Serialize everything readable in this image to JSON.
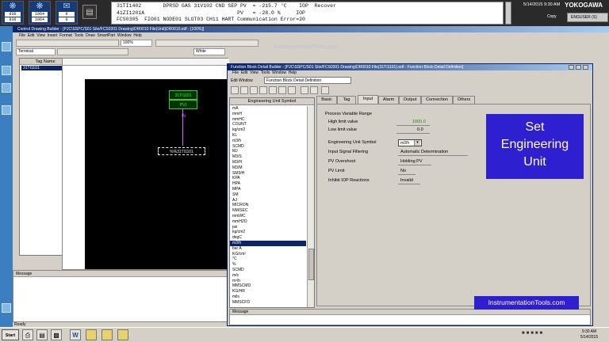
{
  "system_bar": {
    "icons": [
      {
        "count_top": "936",
        "count_bottom": "936"
      },
      {
        "count_top": "1064",
        "count_bottom": "1064"
      },
      {
        "count_top": "0",
        "count_bottom": "0"
      }
    ],
    "alarm_lines": [
      "31TI1402       DPRSD GAS 31V102 CND SEP PV  = -215.7 °C    IOP  Recover",
      "41ZI1201A                              PV   = -28.0 %     IOP",
      "FCS0305  FIO01 NODE01 SLOT03 CH11 HART Communication Error=20"
    ],
    "date": "5/14/2015",
    "time": "9:30 AM",
    "logo": "YOKOGAWA",
    "copy_label": "Copy",
    "user": "ENGUSER (S)"
  },
  "cdb": {
    "title": "Control Drawing Builder - [PJC\\SSPC/S01 Site/FCS0301 Drawing\\DR0010 File(Unit)DR0010.edf - [100%]]",
    "menu": [
      "File",
      "Edit",
      "View",
      "Insert",
      "Format",
      "Tools",
      "Draw",
      "SmartPart",
      "Window",
      "Help"
    ],
    "toolbar_zoom": "100%",
    "toolbar_font": "Terminal",
    "toolbar_color": "White",
    "tag_list_header": "Tag Name",
    "tag_selected": "31TI1101",
    "fb_tag": "31TI1101",
    "fb_type": "PVI",
    "fb_output": "IN",
    "fb_terminal": "%%31TI1101",
    "message_header": "Message",
    "status": "Ready"
  },
  "watermark": "InstrumentationTools.com",
  "fbd": {
    "title": "Function Block Detail Builder - [PJC\\SSPC/S01 Site/FCS0301 Drawing\\DR0010 File(31TI1101).edf - Function Block Detail Definition]",
    "menu": [
      "File",
      "Edit",
      "View",
      "Tools",
      "Window",
      "Help"
    ],
    "edit_window_label": "Edit Window",
    "edit_window_value": "Function Block Detail Definition",
    "eu_header": "Engineering Unit Symbol",
    "eu_items": [
      "mA",
      "mmH",
      "mmHC",
      "COUNT",
      "kg/cm2",
      "KL",
      "m3/h",
      "SCMD",
      "MJ",
      "M3/S",
      "M3/H",
      "M3/M",
      "SM3/H",
      "KPA",
      "HPA",
      "MPA",
      "SM",
      "AJ",
      "MICRON",
      "NM/SEC",
      "mmWC",
      "mmH2O",
      "psi",
      "kg/cm2",
      "degC",
      "m3/h",
      "bar A",
      "KG/cm²",
      "°C",
      "%",
      "SCMD",
      "m/s",
      "m³/h",
      "MMSCMD",
      "KG/HR",
      "mils",
      "MMSCFD"
    ],
    "eu_selected_index": 25,
    "tabs": [
      "Basic",
      "Tag",
      "Input",
      "Alarm",
      "Output",
      "Connection",
      "Others"
    ],
    "active_tab": "Input",
    "params": {
      "pv_range_label": "Process Variable Range",
      "high_limit_label": "High limit value",
      "high_limit_value": "1000.0",
      "low_limit_label": "Low limit value",
      "low_limit_value": "0.0",
      "eu_symbol_label": "Engineering Unit Symbol",
      "eu_symbol_value": "m3/h",
      "signal_filtering_label": "Input Signal Filtering",
      "signal_filtering_value": "Automatic Determination",
      "pv_overshoot_label": "PV Overshoot",
      "pv_overshoot_value": "Holding PV",
      "pv_limit_label": "PV Limit",
      "pv_limit_value": "No",
      "inhibit_label": "Inhibit IOP Reactions",
      "inhibit_value": "Invalid"
    },
    "message_header": "Message"
  },
  "callout": {
    "line1": "Set",
    "line2": "Engineering",
    "line3": "Unit"
  },
  "brand": "InstrumentationTools.com",
  "taskbar": {
    "start": "Start",
    "clock_time": "9:30 AM",
    "clock_date": "5/14/2015"
  },
  "colors": {
    "callout_bg": "#2e1fd1",
    "selection": "#0a246a",
    "desktop": "#1e6ea8"
  }
}
